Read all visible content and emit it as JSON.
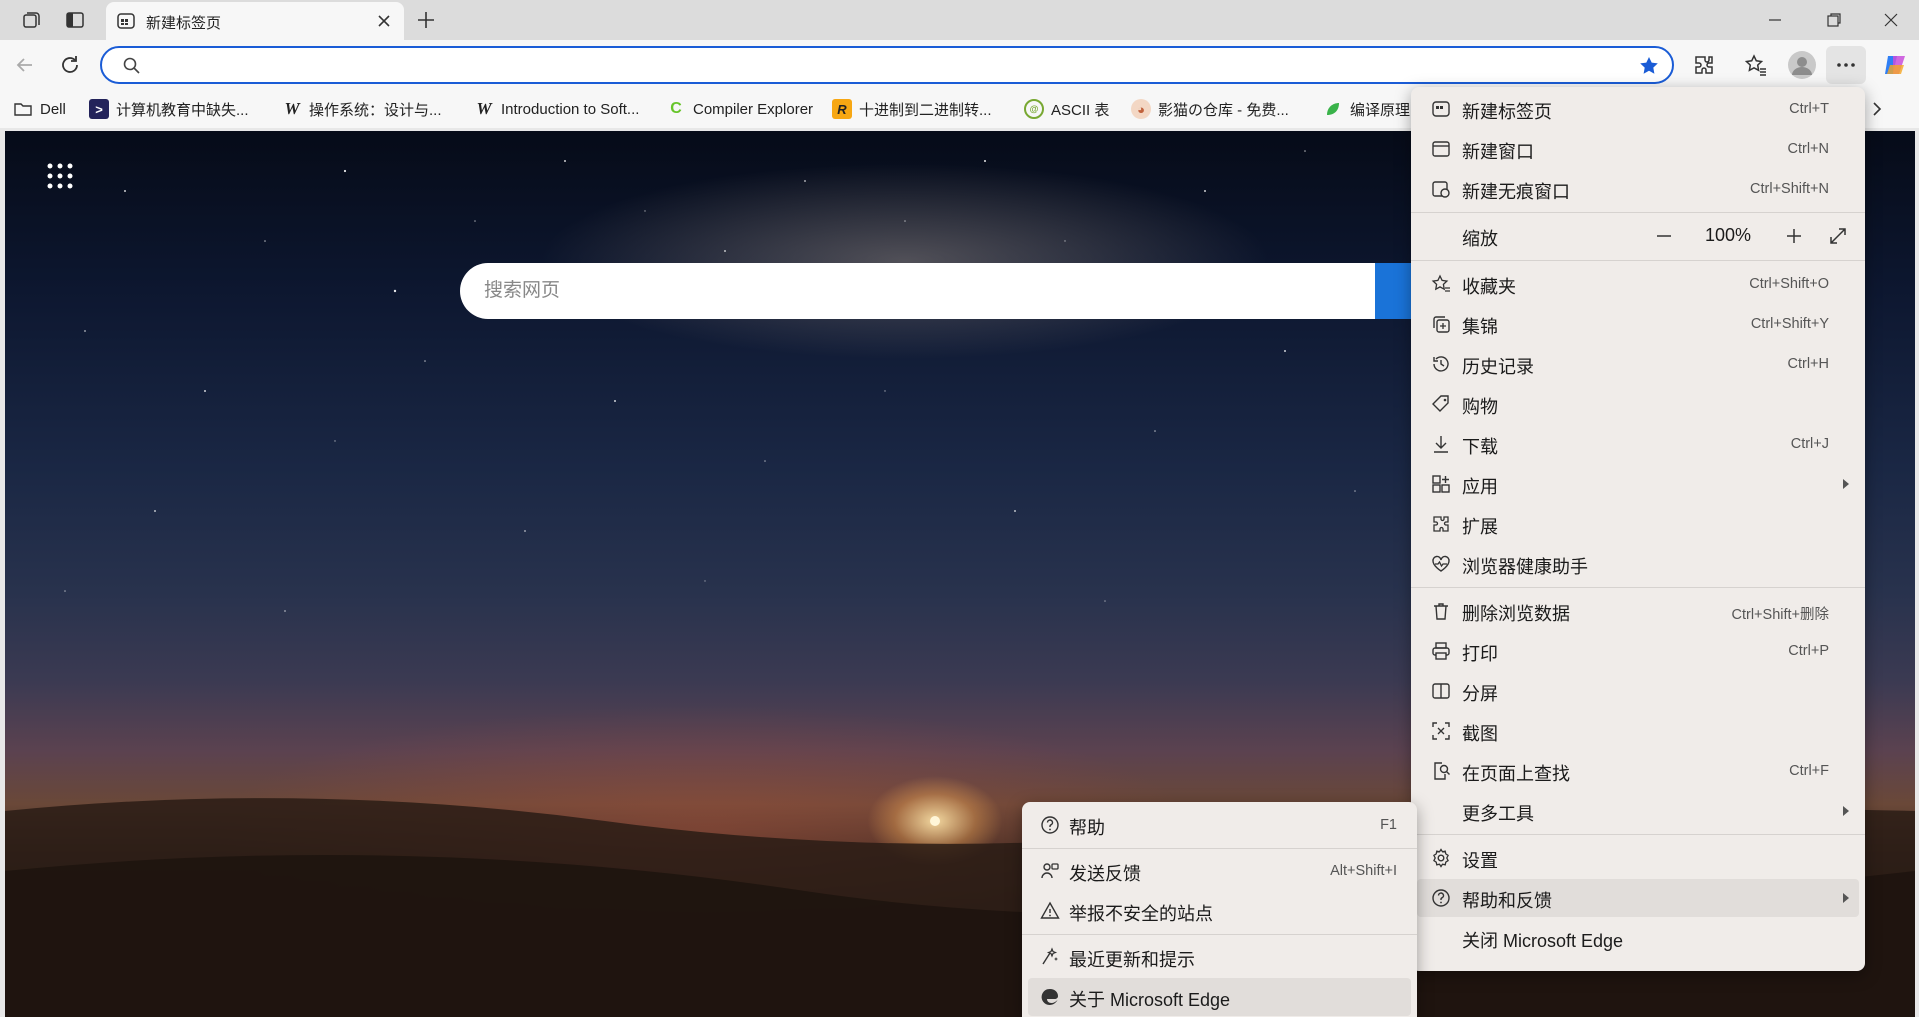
{
  "browser": {
    "tab": {
      "title": "新建标签页"
    },
    "address_bar": {
      "value": "",
      "placeholder": ""
    }
  },
  "bookmarks": [
    {
      "label": "Dell",
      "icon": "folder-icon"
    },
    {
      "label": "计算机教育中缺失...",
      "icon": "missing-semester-icon"
    },
    {
      "label": "操作系统：设计与...",
      "icon": "w-icon"
    },
    {
      "label": "Introduction to Soft...",
      "icon": "w-icon"
    },
    {
      "label": "Compiler Explorer",
      "icon": "compiler-explorer-icon"
    },
    {
      "label": "十进制到二进制转...",
      "icon": "r-icon"
    },
    {
      "label": "ASCII 表",
      "icon": "ascii-icon"
    },
    {
      "label": "影猫の仓库 - 免费...",
      "icon": "cat-icon"
    },
    {
      "label": "编译原理",
      "icon": "leaf-icon"
    }
  ],
  "newtab": {
    "search_placeholder": "搜索网页"
  },
  "menu": {
    "items": [
      {
        "label": "新建标签页",
        "shortcut": "Ctrl+T"
      },
      {
        "label": "新建窗口",
        "shortcut": "Ctrl+N"
      },
      {
        "label": "新建无痕窗口",
        "shortcut": "Ctrl+Shift+N"
      },
      {
        "label": "缩放",
        "zoom": "100%"
      },
      {
        "label": "收藏夹",
        "shortcut": "Ctrl+Shift+O"
      },
      {
        "label": "集锦",
        "shortcut": "Ctrl+Shift+Y"
      },
      {
        "label": "历史记录",
        "shortcut": "Ctrl+H"
      },
      {
        "label": "购物",
        "shortcut": ""
      },
      {
        "label": "下载",
        "shortcut": "Ctrl+J"
      },
      {
        "label": "应用",
        "shortcut": ""
      },
      {
        "label": "扩展",
        "shortcut": ""
      },
      {
        "label": "浏览器健康助手",
        "shortcut": ""
      },
      {
        "label": "删除浏览数据",
        "shortcut": "Ctrl+Shift+删除"
      },
      {
        "label": "打印",
        "shortcut": "Ctrl+P"
      },
      {
        "label": "分屏",
        "shortcut": ""
      },
      {
        "label": "截图",
        "shortcut": ""
      },
      {
        "label": "在页面上查找",
        "shortcut": "Ctrl+F"
      },
      {
        "label": "更多工具",
        "shortcut": ""
      },
      {
        "label": "设置",
        "shortcut": ""
      },
      {
        "label": "帮助和反馈",
        "shortcut": ""
      },
      {
        "label": "关闭 Microsoft Edge",
        "shortcut": ""
      }
    ]
  },
  "submenu": {
    "items": [
      {
        "label": "帮助",
        "shortcut": "F1"
      },
      {
        "label": "发送反馈",
        "shortcut": "Alt+Shift+I"
      },
      {
        "label": "举报不安全的站点",
        "shortcut": ""
      },
      {
        "label": "最近更新和提示",
        "shortcut": ""
      },
      {
        "label": "关于 Microsoft Edge",
        "shortcut": ""
      }
    ]
  },
  "colors": {
    "accent": "#1a5cd6",
    "menu_bg": "#f0ece9",
    "menu_hover": "#e1ddda"
  }
}
